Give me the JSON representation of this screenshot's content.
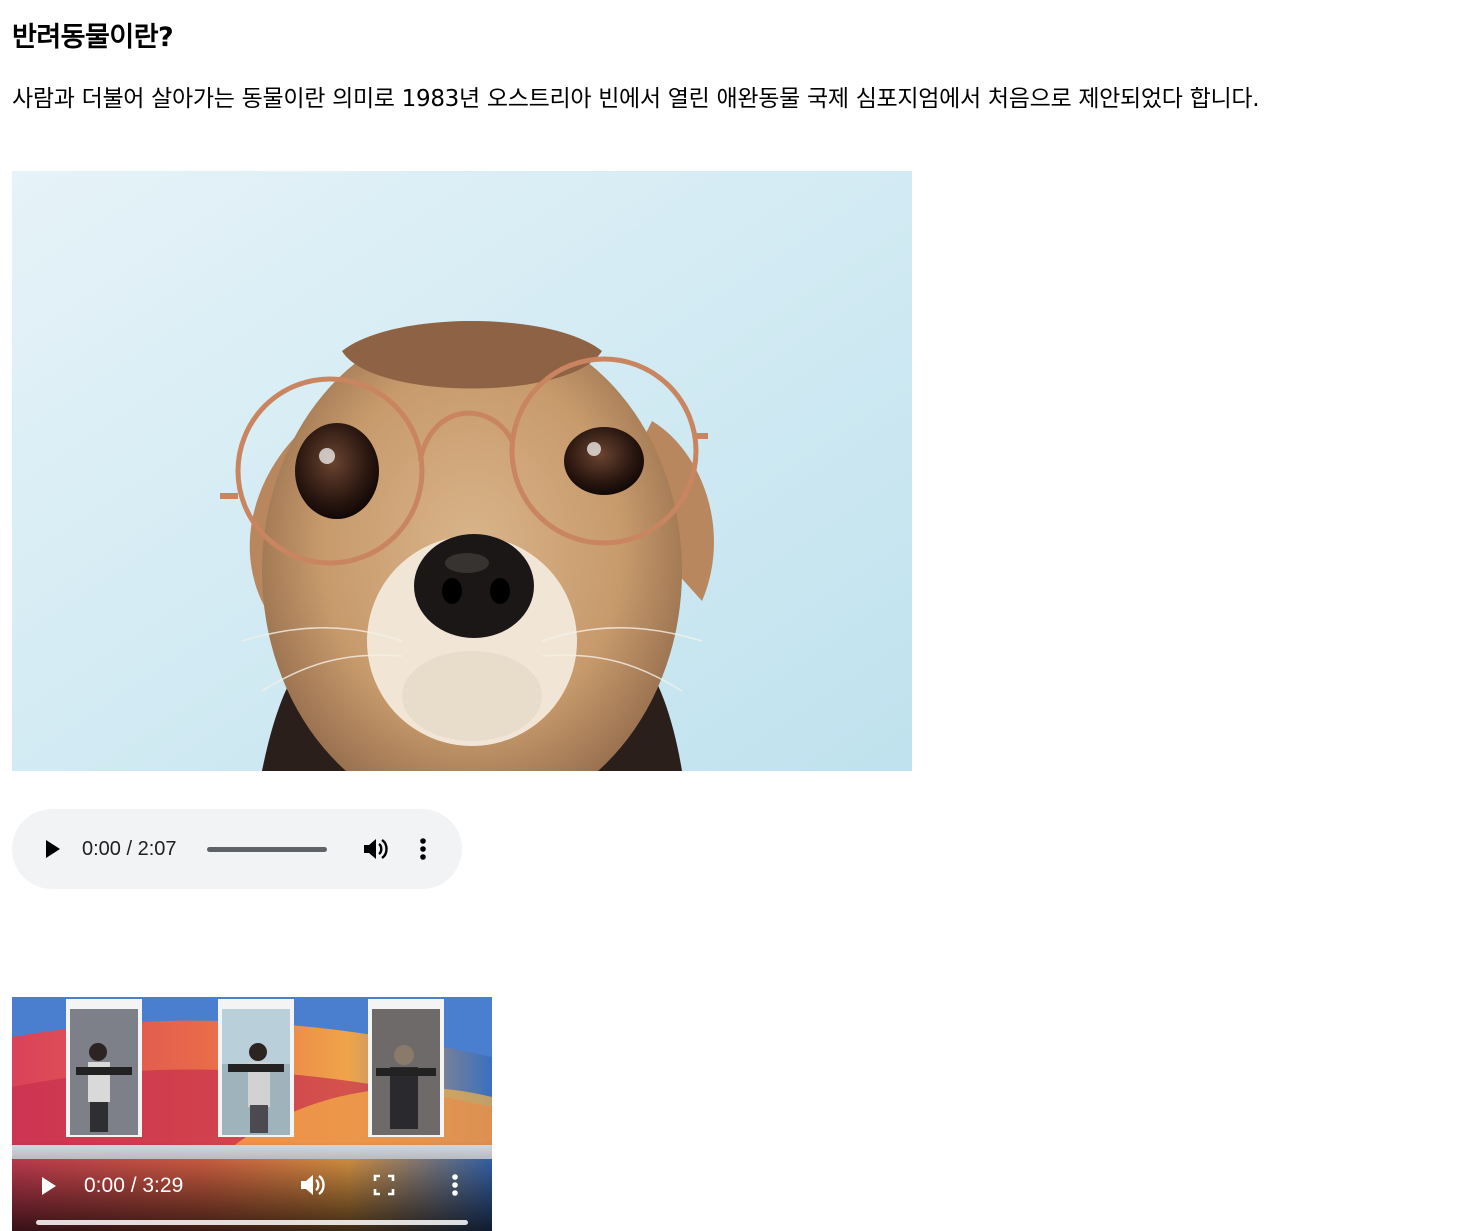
{
  "article": {
    "heading": "반려동물이란?",
    "description": "사람과 더불어 살아가는 동물이란 의미로 1983년 오스트리아 빈에서 열린 애완동물 국제 심포지엄에서 처음으로 제안되었다 합니다."
  },
  "image": {
    "subject": "dog-wearing-round-glasses",
    "background_color": "#cfe8f2"
  },
  "audio_player": {
    "time_display": "0:00 / 2:07",
    "progress_fraction": 0,
    "icons": [
      "play-icon",
      "volume-icon",
      "more-options-icon"
    ],
    "background_color": "#f1f3f4"
  },
  "video_player": {
    "time_display": "0:00 / 3:29",
    "progress_fraction": 0,
    "icons": [
      "play-icon",
      "volume-icon",
      "fullscreen-icon",
      "more-options-icon"
    ],
    "thumbnail_captions": [
      "",
      "",
      ""
    ]
  }
}
